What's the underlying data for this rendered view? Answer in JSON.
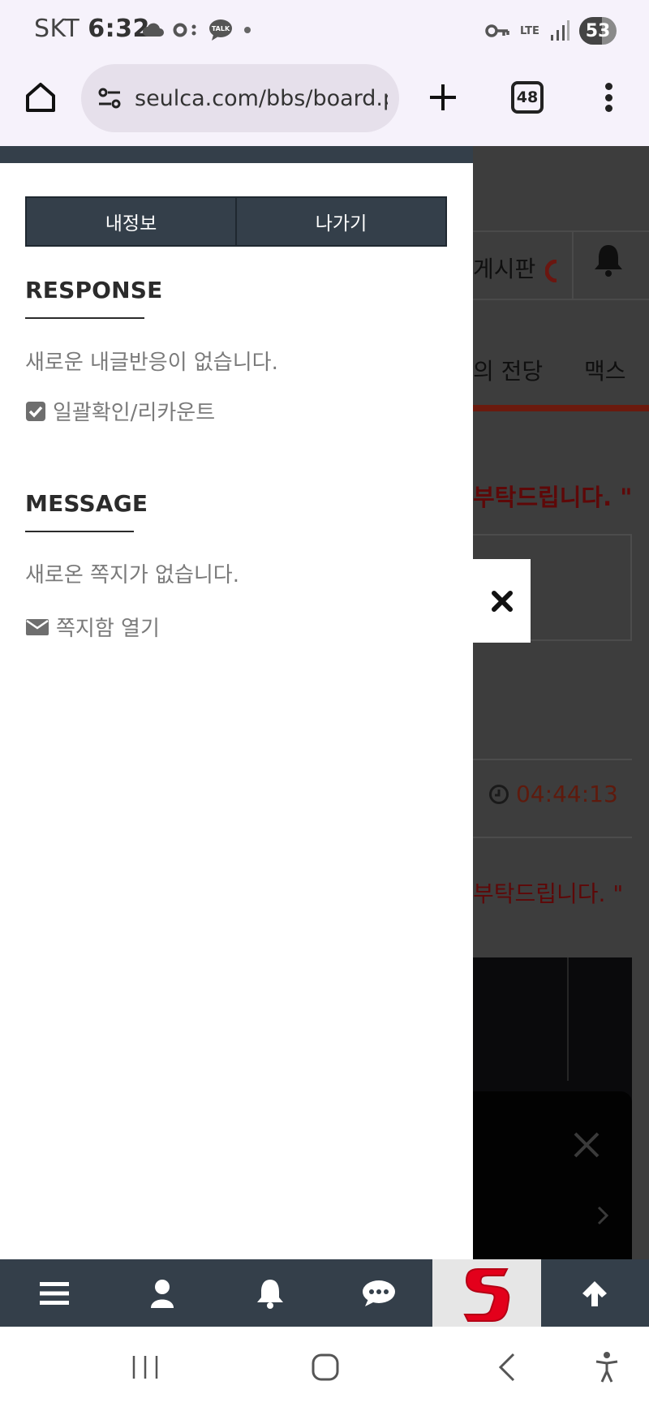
{
  "status_bar": {
    "carrier": "SKT",
    "time": "6:32",
    "network": "LTE",
    "battery": "53",
    "icons": [
      "cloud-icon",
      "voicemail-icon",
      "talk-icon",
      "dot-icon",
      "key-icon",
      "signal-icon"
    ],
    "talk_label": "TALK"
  },
  "browser": {
    "url": "seulca.com/bbs/board.ph",
    "tab_count": "48"
  },
  "background_page": {
    "board_label": "게시판",
    "hall_label": "의 전당",
    "max_label": "맥스",
    "notice": "부탁드립니다. \"",
    "notice2": "부탁드립니다. \"",
    "time": "04:44:13"
  },
  "drawer": {
    "buttons": {
      "my_info": "내정보",
      "exit": "나가기"
    },
    "response": {
      "title": "RESPONSE",
      "empty_text": "새로운 내글반응이 없습니다.",
      "confirm_link": "일괄확인/리카운트"
    },
    "message": {
      "title": "MESSAGE",
      "empty_text": "새로온 쪽지가 없습니다.",
      "open_link": "쪽지함 열기"
    }
  },
  "bottom_nav": {
    "items": [
      "menu-icon",
      "user-icon",
      "bell-icon",
      "chat-icon",
      "site-logo",
      "arrow-up-icon"
    ]
  },
  "colors": {
    "drawer_dark": "#343f4a",
    "overlay": "#3d3d3d",
    "accent_red": "#e3001b",
    "browser_bg": "#f6f2fb"
  }
}
